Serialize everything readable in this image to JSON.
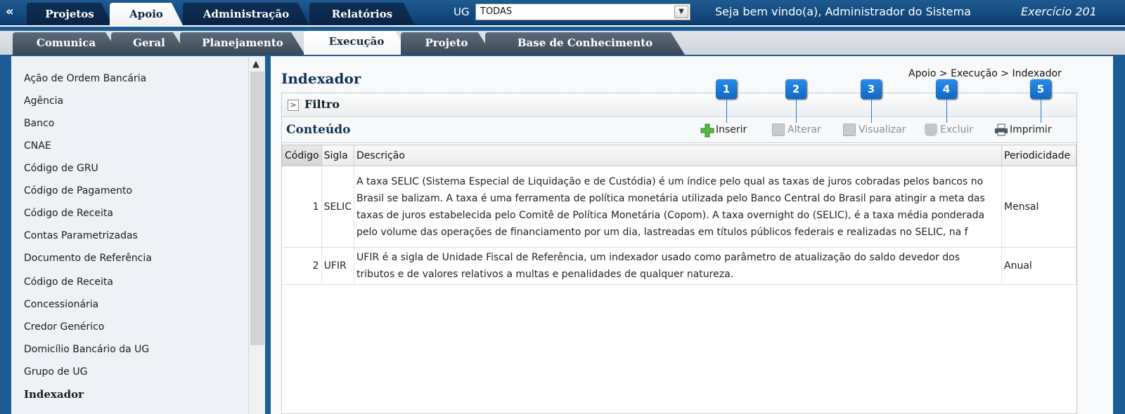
{
  "top_tabs": [
    "Projetos",
    "Apoio",
    "Administração",
    "Relatórios"
  ],
  "active_top_tab": "Apoio",
  "collapse_glyph": "«",
  "ug": {
    "label": "UG",
    "value": "TODAS"
  },
  "welcome": "Seja bem vindo(a), Administrador do Sistema",
  "exercicio": "Exercício 201",
  "sub_tabs": [
    "Comunica",
    "Geral",
    "Planejamento",
    "Execução",
    "Projeto",
    "Base de Conhecimento"
  ],
  "active_sub_tab": "Execução",
  "sidebar": {
    "items": [
      "Ação de Ordem Bancária",
      "Agência",
      "Banco",
      "CNAE",
      "Código de GRU",
      "Código de Pagamento",
      "Código de Receita",
      "Contas Parametrizadas",
      "Documento de Referência",
      "Código de Receita",
      "Concessionária",
      "Credor Genérico",
      "Domicílio Bancário da UG",
      "Grupo de UG",
      "Indexador"
    ],
    "selected": "Indexador"
  },
  "page": {
    "title": "Indexador",
    "breadcrumb": "Apoio > Execução > Indexador"
  },
  "filtro": {
    "toggle_glyph": ">",
    "label": "Filtro"
  },
  "conteudo": {
    "label": "Conteúdo"
  },
  "toolbar": {
    "inserir": "Inserir",
    "alterar": "Alterar",
    "visualizar": "Visualizar",
    "excluir": "Excluir",
    "imprimir": "Imprimir"
  },
  "callouts": [
    "1",
    "2",
    "3",
    "4",
    "5"
  ],
  "table": {
    "headers": [
      "Código",
      "Sigla",
      "Descrição",
      "Periodicidade"
    ],
    "rows": [
      {
        "codigo": "1",
        "sigla": "SELIC",
        "descricao": "A taxa SELIC (Sistema Especial de Liquidação e de Custódia) é um índice pelo qual as taxas de juros cobradas pelos bancos no Brasil se balizam. A taxa é uma ferramenta de política monetária utilizada pelo Banco Central do Brasil para atingir a meta das taxas de juros estabelecida pelo Comitê de Política Monetária (Copom). A taxa overnight do (SELIC), é a taxa média ponderada pelo volume das operações de financiamento por um dia, lastreadas em títulos públicos federais e realizadas no SELIC, na f",
        "periodicidade": "Mensal"
      },
      {
        "codigo": "2",
        "sigla": "UFIR",
        "descricao": "UFIR é a sigla de Unidade Fiscal de Referência, um indexador usado como parâmetro de atualização do saldo devedor dos tributos e de valores relativos a multas e penalidades de qualquer natureza.",
        "periodicidade": "Anual"
      }
    ]
  },
  "colors": {
    "brand_blue": "#1d5d96",
    "callout_blue": "#1f7ad8",
    "title_navy": "#123356"
  }
}
